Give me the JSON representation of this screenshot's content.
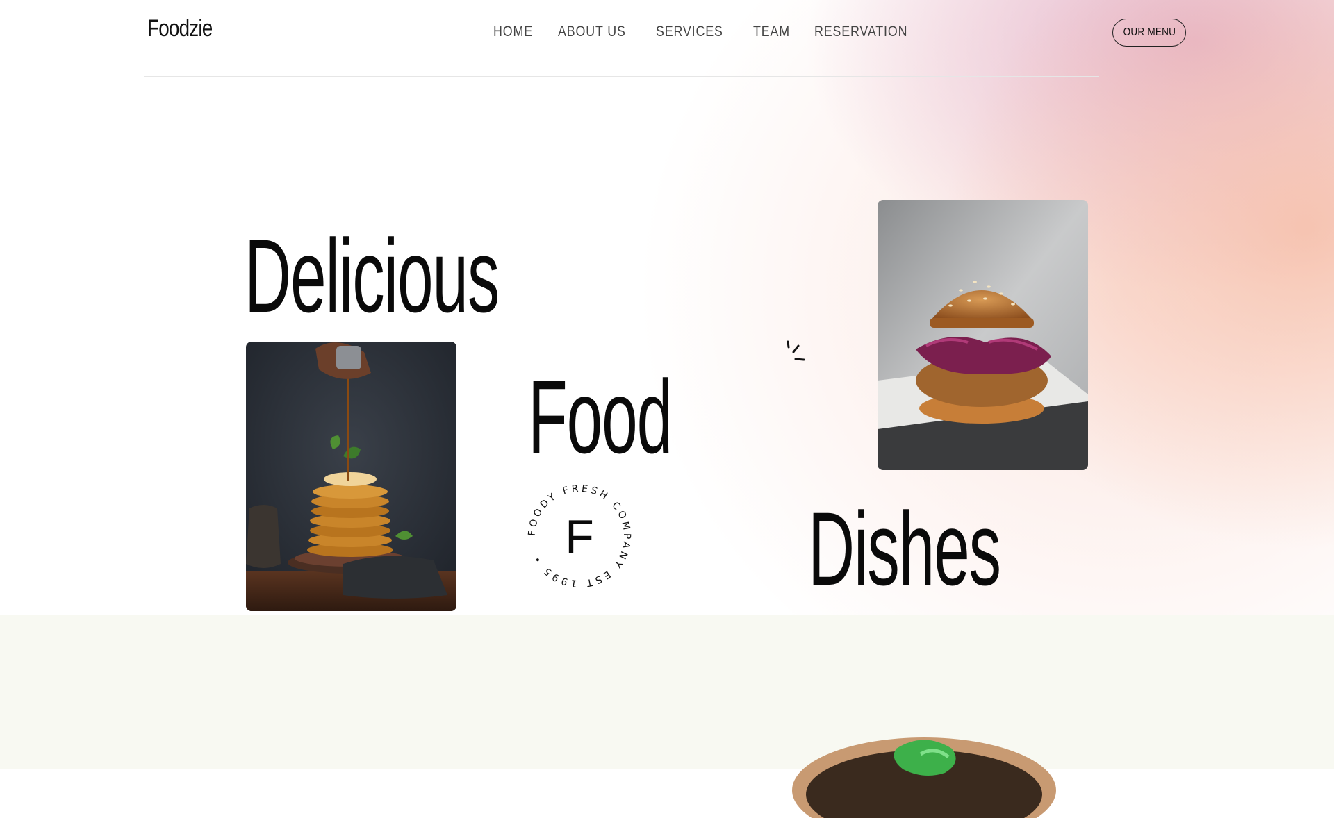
{
  "header": {
    "logo": "Foodzie",
    "nav": [
      "HOME",
      "ABOUT US",
      "SERVICES",
      "TEAM",
      "RESERVATION"
    ],
    "menu_button": "OUR MENU"
  },
  "hero": {
    "word1": "Delicious",
    "word2": "Food",
    "word3": "Dishes",
    "badge": {
      "letter": "F",
      "ring_text": "FOODY FRESH COMPANY EST 1995 •"
    }
  },
  "colors": {
    "text": "#0a0a0a",
    "nav_text": "#444444",
    "lower_bg": "#f8f9f2",
    "gradient_pink": "#e0aac4",
    "gradient_peach": "#f6bea8"
  },
  "icons": [
    "sparkle-icon",
    "circular-badge"
  ]
}
